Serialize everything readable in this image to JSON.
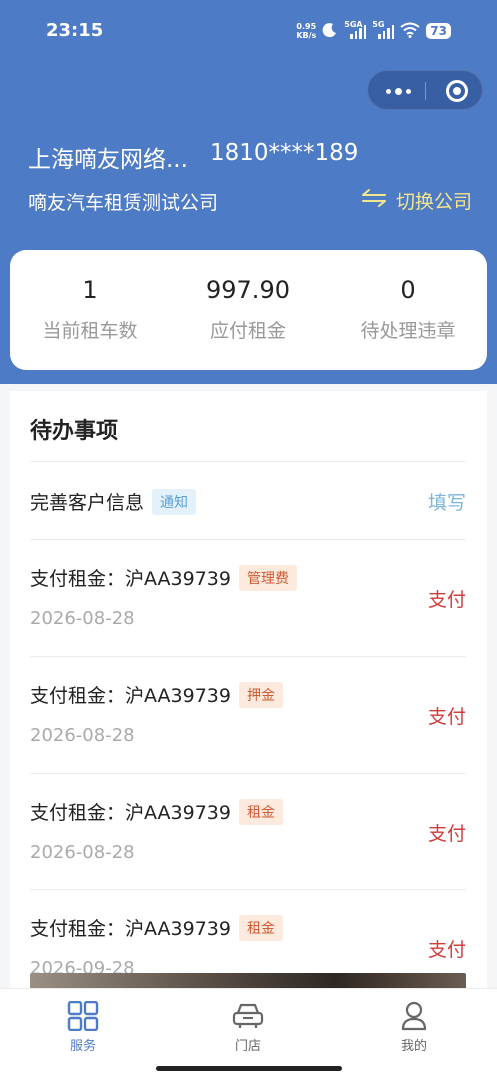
{
  "status_bar": {
    "time": "23:15",
    "net_speed_value": "0.95",
    "net_speed_unit": "KB/s",
    "signal1_label": "5GA",
    "signal2_label": "5G",
    "battery": "73"
  },
  "header": {
    "company_name": "上海嘀友网络...",
    "phone": "1810****189",
    "subcompany": "嘀友汽车租赁测试公司",
    "switch_label": "切换公司",
    "background_color": "#4e7bc6",
    "switch_color": "#f4e78a"
  },
  "summary": {
    "items": [
      {
        "value": "1",
        "label": "当前租车数"
      },
      {
        "value": "997.90",
        "label": "应付租金"
      },
      {
        "value": "0",
        "label": "待处理违章"
      }
    ]
  },
  "todo": {
    "title": "待办事项",
    "items": [
      {
        "text": "完善客户信息",
        "tag": "通知",
        "action": "填写"
      },
      {
        "text": "支付租金：沪AA39739",
        "tag": "管理费",
        "date": "2026-08-28",
        "action": "支付"
      },
      {
        "text": "支付租金：沪AA39739",
        "tag": "押金",
        "date": "2026-08-28",
        "action": "支付"
      },
      {
        "text": "支付租金：沪AA39739",
        "tag": "租金",
        "date": "2026-08-28",
        "action": "支付"
      },
      {
        "text": "支付租金：沪AA39739",
        "tag": "租金",
        "date": "2026-09-28",
        "action": "支付"
      }
    ]
  },
  "tabbar": {
    "tabs": [
      {
        "label": "服务",
        "icon": "grid-icon",
        "active": true
      },
      {
        "label": "门店",
        "icon": "car-icon",
        "active": false
      },
      {
        "label": "我的",
        "icon": "person-icon",
        "active": false
      }
    ],
    "active_color": "#4e7bc6",
    "inactive_color": "#666666"
  }
}
